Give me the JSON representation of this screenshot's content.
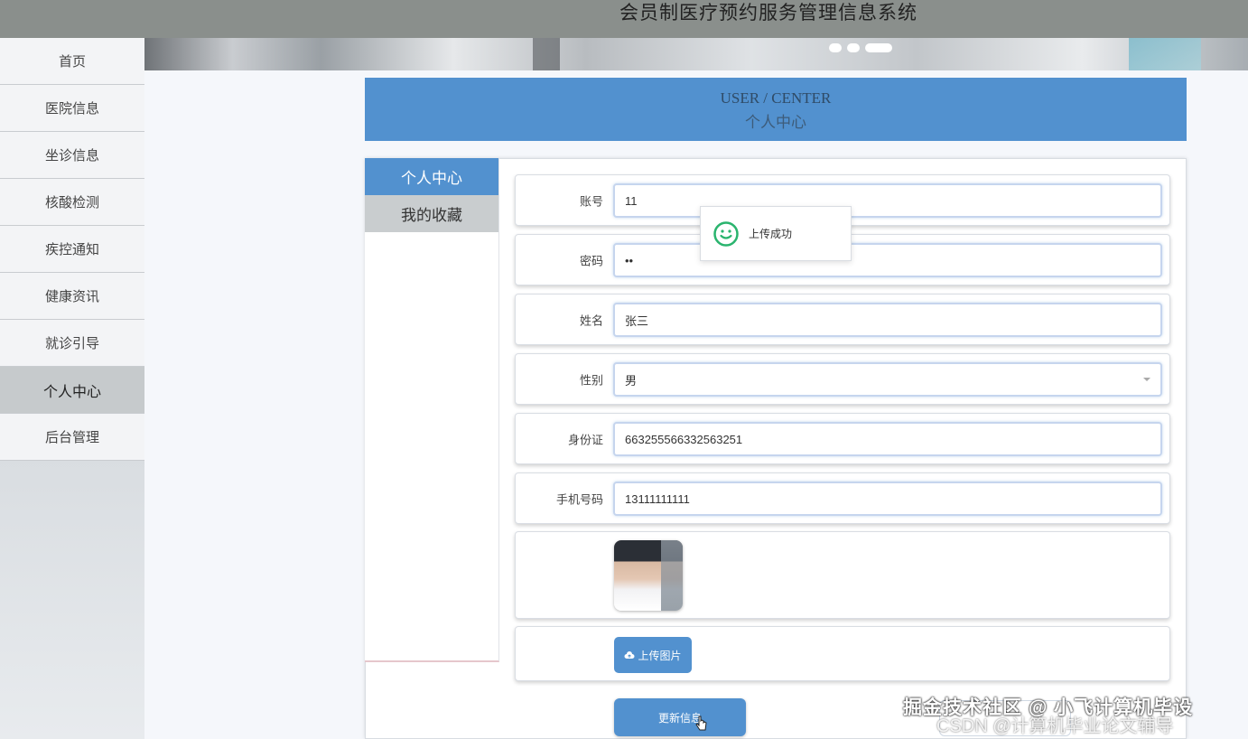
{
  "site": {
    "title": "会员制医疗预约服务管理信息系统"
  },
  "sidebar": {
    "items": [
      {
        "label": "首页"
      },
      {
        "label": "医院信息"
      },
      {
        "label": "坐诊信息"
      },
      {
        "label": "核酸检测"
      },
      {
        "label": "疾控通知"
      },
      {
        "label": "健康资讯"
      },
      {
        "label": "就诊引导"
      },
      {
        "label": "个人中心",
        "active": true
      },
      {
        "label": "后台管理"
      }
    ]
  },
  "header": {
    "en": "USER / CENTER",
    "cn": "个人中心"
  },
  "center_nav": {
    "items": [
      {
        "label": "个人中心",
        "active": true
      },
      {
        "label": "我的收藏"
      }
    ]
  },
  "form": {
    "account": {
      "label": "账号",
      "value": "11"
    },
    "password": {
      "label": "密码",
      "value": "••"
    },
    "name": {
      "label": "姓名",
      "value": "张三"
    },
    "gender": {
      "label": "性别",
      "value": "男"
    },
    "id_card": {
      "label": "身份证",
      "value": "663255566332563251"
    },
    "phone": {
      "label": "手机号码",
      "value": "13111111111"
    },
    "upload_label": "上传图片",
    "update_label": "更新信息"
  },
  "toast": {
    "message": "上传成功"
  },
  "watermark": {
    "line1": "掘金技术社区 @ 小飞计算机毕设",
    "line2": "CSDN @计算机毕业论文辅导"
  },
  "colors": {
    "accent": "#5291cf",
    "success": "#2ab46e"
  }
}
